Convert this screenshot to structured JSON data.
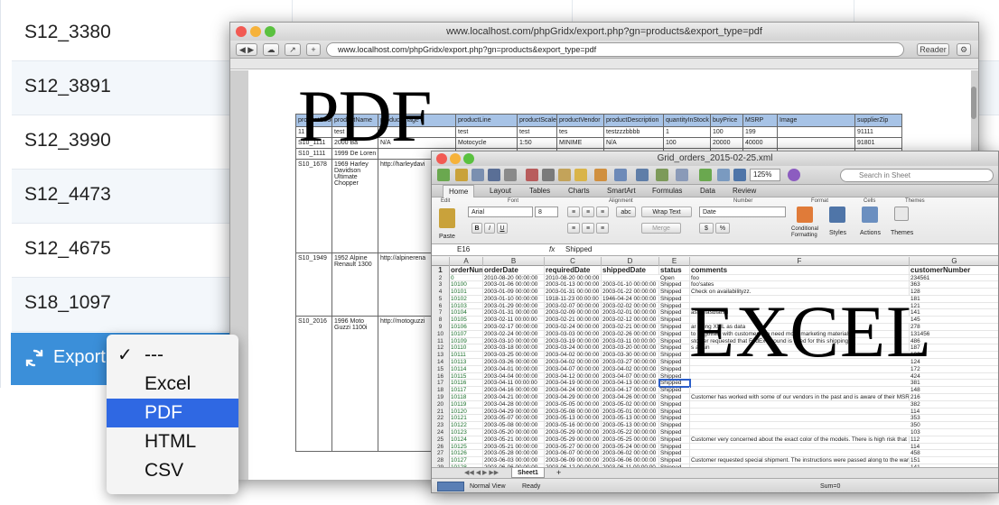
{
  "background": {
    "product_codes": [
      "S12_3380",
      "S12_3891",
      "S12_3990",
      "S12_4473",
      "S12_4675",
      "S18_1097"
    ],
    "export_label": "Export"
  },
  "dropdown": {
    "items": [
      {
        "label": "---",
        "checked": true,
        "highlighted": false
      },
      {
        "label": "Excel",
        "checked": false,
        "highlighted": false
      },
      {
        "label": "PDF",
        "checked": false,
        "highlighted": true
      },
      {
        "label": "HTML",
        "checked": false,
        "highlighted": false
      },
      {
        "label": "CSV",
        "checked": false,
        "highlighted": false
      }
    ],
    "check_glyph": "✓"
  },
  "pdf_window": {
    "title": "www.localhost.com/phpGridx/export.php?gn=products&export_type=pdf",
    "url": "www.localhost.com/phpGridx/export.php?gn=products&export_type=pdf",
    "reader_label": "Reader",
    "big_label": "PDF",
    "table": {
      "columns": [
        "productCode",
        "productName",
        "productImage",
        "productLine",
        "productScale",
        "productVendor",
        "productDescription",
        "quantityInStock",
        "buyPrice",
        "MSRP",
        "Image",
        "supplierZip"
      ],
      "rows": [
        [
          "11",
          "test",
          "",
          "test",
          "test",
          "tes",
          "testzzzbbbb",
          "1",
          "100",
          "199",
          "",
          "91111"
        ],
        [
          "S10_1111",
          "2000 Ba",
          "N/A",
          "Motocycle",
          "1:50",
          "MINIME",
          "N/A",
          "100",
          "20000",
          "40000",
          "",
          "91801"
        ],
        [
          "S10_1111",
          "1999 De Loren",
          "",
          "",
          "",
          "",
          "",
          "",
          "",
          "",
          "",
          ""
        ],
        [
          "S10_1678",
          "1969 Harley Davidson Ultimate Chopper",
          "http://harleydavi",
          "",
          "",
          "",
          "",
          "",
          "",
          "",
          "",
          ""
        ],
        [
          "S10_1949",
          "1952 Alpine Renault 1300",
          "http://alpinerena",
          "",
          "",
          "",
          "",
          "",
          "",
          "",
          "",
          ""
        ],
        [
          "S10_2016",
          "1996 Moto Guzzi 1100i",
          "http://motoguzzi",
          "",
          "",
          "",
          "",
          "",
          "",
          "",
          "",
          ""
        ]
      ]
    }
  },
  "excel_window": {
    "title": "Grid_orders_2015-02-25.xml",
    "search_placeholder": "Search in Sheet",
    "zoom": "125%",
    "tabs": [
      "Home",
      "Layout",
      "Tables",
      "Charts",
      "SmartArt",
      "Formulas",
      "Data",
      "Review"
    ],
    "ribbon": {
      "groups": [
        "Edit",
        "Font",
        "Alignment",
        "Number",
        "Format",
        "Cells",
        "Themes"
      ],
      "font_name": "Arial",
      "font_size": "8",
      "wrap_text": "Wrap Text",
      "merge": "Merge",
      "number_format": "Date",
      "paste": "Paste",
      "conditional_formatting": "Conditional Formatting",
      "styles": "Styles",
      "actions": "Actions",
      "themes": "Themes",
      "abc": "abc"
    },
    "formula_bar": {
      "cell_ref": "E16",
      "fx": "fx",
      "value": "Shipped"
    },
    "columns": [
      "A",
      "B",
      "C",
      "D",
      "E",
      "F",
      "G"
    ],
    "header_row": [
      "orderNumb",
      "orderDate",
      "requiredDate",
      "shippedDate",
      "status",
      "comments",
      "customerNumber"
    ],
    "rows": [
      [
        "0",
        "2010-08-20 00:00:00",
        "2010-08-20 00:00:00",
        "",
        "Open",
        "foo",
        "234561"
      ],
      [
        "10100",
        "2003-01-06 00:00:00",
        "2003-01-13 00:00:00",
        "2003-01-10 00:00:00",
        "Shipped",
        "foo'sates",
        "363"
      ],
      [
        "10101",
        "2003-01-09 00:00:00",
        "2003-01-31 00:00:00",
        "2003-01-22 00:00:00",
        "Shipped",
        "Check on availabilityzz.",
        "128"
      ],
      [
        "10102",
        "2003-01-10 00:00:00",
        "1918-11-23 00:00:00",
        "1946-04-24 00:00:00",
        "Shipped",
        "",
        "181"
      ],
      [
        "10103",
        "2003-01-29 00:00:00",
        "2003-02-07 00:00:00",
        "2003-02-02 00:00:00",
        "Shipped",
        "",
        "121"
      ],
      [
        "10104",
        "2003-01-31 00:00:00",
        "2003-02-09 00:00:00",
        "2003-02-01 00:00:00",
        "Shipped",
        "asfasfasdfafsd",
        "141"
      ],
      [
        "10105",
        "2003-02-11 00:00:00",
        "2003-02-21 00:00:00",
        "2003-02-12 00:00:00",
        "Shipped",
        "",
        "145"
      ],
      [
        "10106",
        "2003-02-17 00:00:00",
        "2003-02-24 00:00:00",
        "2003-02-21 00:00:00",
        "Shipped",
        "ar using XML as data",
        "278"
      ],
      [
        "10107",
        "2003-02-24 00:00:00",
        "2003-03-03 00:00:00",
        "2003-02-26 00:00:00",
        "Shipped",
        "to negotiate with customer. We need more marketing materials",
        "131456"
      ],
      [
        "10109",
        "2003-03-10 00:00:00",
        "2003-03-19 00:00:00",
        "2003-03-11 00:00:00",
        "Shipped",
        "stomer requested that FedEx Ground is used for this shipping",
        "486"
      ],
      [
        "10110",
        "2003-03-18 00:00:00",
        "2003-03-24 00:00:00",
        "2003-03-20 00:00:00",
        "Shipped",
        "s again",
        "187"
      ],
      [
        "10111",
        "2003-03-25 00:00:00",
        "2003-04-02 00:00:00",
        "2003-03-30 00:00:00",
        "Shipped",
        "",
        "129"
      ],
      [
        "10113",
        "2003-03-26 00:00:00",
        "2003-04-02 00:00:00",
        "2003-03-27 00:00:00",
        "Shipped",
        "",
        "124"
      ],
      [
        "10114",
        "2003-04-01 00:00:00",
        "2003-04-07 00:00:00",
        "2003-04-02 00:00:00",
        "Shipped",
        "",
        "172"
      ],
      [
        "10115",
        "2003-04-04 00:00:00",
        "2003-04-12 00:00:00",
        "2003-04-07 00:00:00",
        "Shipped",
        "",
        "424"
      ],
      [
        "10116",
        "2003-04-11 00:00:00",
        "2003-04-19 00:00:00",
        "2003-04-13 00:00:00",
        "Shipped",
        "",
        "381"
      ],
      [
        "10117",
        "2003-04-16 00:00:00",
        "2003-04-24 00:00:00",
        "2003-04-17 00:00:00",
        "Shipped",
        "",
        "148"
      ],
      [
        "10118",
        "2003-04-21 00:00:00",
        "2003-04-29 00:00:00",
        "2003-04-26 00:00:00",
        "Shipped",
        "Customer has worked with some of our vendors in the past and is aware of their MSRP",
        "216"
      ],
      [
        "10119",
        "2003-04-28 00:00:00",
        "2003-05-05 00:00:00",
        "2003-05-02 00:00:00",
        "Shipped",
        "",
        "382"
      ],
      [
        "10120",
        "2003-04-29 00:00:00",
        "2003-05-08 00:00:00",
        "2003-05-01 00:00:00",
        "Shipped",
        "",
        "114"
      ],
      [
        "10121",
        "2003-05-07 00:00:00",
        "2003-05-13 00:00:00",
        "2003-05-13 00:00:00",
        "Shipped",
        "",
        "353"
      ],
      [
        "10122",
        "2003-05-08 00:00:00",
        "2003-05-16 00:00:00",
        "2003-05-13 00:00:00",
        "Shipped",
        "",
        "350"
      ],
      [
        "10123",
        "2003-05-20 00:00:00",
        "2003-05-29 00:00:00",
        "2003-05-22 00:00:00",
        "Shipped",
        "",
        "103"
      ],
      [
        "10124",
        "2003-05-21 00:00:00",
        "2003-05-29 00:00:00",
        "2003-05-25 00:00:00",
        "Shipped",
        "Customer very concerned about the exact color of the models. There is high risk that he may",
        "112"
      ],
      [
        "10125",
        "2003-05-21 00:00:00",
        "2003-05-27 00:00:00",
        "2003-05-24 00:00:00",
        "Shipped",
        "",
        "114"
      ],
      [
        "10126",
        "2003-05-28 00:00:00",
        "2003-06-07 00:00:00",
        "2003-06-02 00:00:00",
        "Shipped",
        "",
        "458"
      ],
      [
        "10127",
        "2003-06-03 00:00:00",
        "2003-06-09 00:00:00",
        "2003-06-06 00:00:00",
        "Shipped",
        "Customer requested special shipment. The instructions were passed along to the warehouse",
        "151"
      ],
      [
        "10128",
        "2003-06-06 00:00:00",
        "2003-06-12 00:00:00",
        "2003-06-11 00:00:00",
        "Shipped",
        "",
        "141"
      ],
      [
        "10129",
        "2003-06-12 00:00:00",
        "2003-06-18 00:00:00",
        "2003-06-14 00:00:00",
        "Shipped",
        "",
        "324"
      ]
    ],
    "selected_row_index": 15,
    "sheet_tab": "Sheet1",
    "status": {
      "view": "Normal View",
      "ready": "Ready",
      "sum": "Sum=0"
    },
    "big_label": "EXCEL"
  },
  "colors": {
    "accent": "#3b8fd9",
    "menu_highlight": "#2f68e3",
    "pdf_header": "#a7c3e6"
  }
}
